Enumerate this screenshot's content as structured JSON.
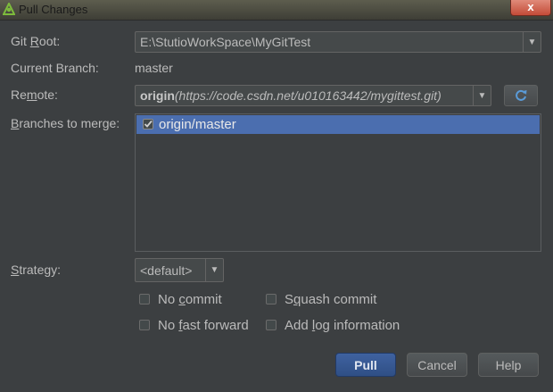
{
  "window": {
    "title": "Pull Changes",
    "close_label": "x"
  },
  "fields": {
    "git_root_label_pre": "Git ",
    "git_root_label_u": "R",
    "git_root_label_post": "oot:",
    "git_root_value": "E:\\StutioWorkSpace\\MyGitTest",
    "current_branch_label": "Current Branch:",
    "current_branch_value": "master",
    "remote_label_pre": "Re",
    "remote_label_u": "m",
    "remote_label_post": "ote:",
    "remote_name": "origin",
    "remote_url": "(https://code.csdn.net/u010163442/mygittest.git)",
    "branches_label_u": "B",
    "branches_label_post": "ranches to merge:",
    "branches": [
      {
        "name": "origin/master",
        "checked": true
      }
    ],
    "strategy_label_u": "S",
    "strategy_label_post": "trategy:",
    "strategy_value": "<default>"
  },
  "options": {
    "no_commit_pre": "No ",
    "no_commit_u": "c",
    "no_commit_post": "ommit",
    "squash_pre": "S",
    "squash_u": "q",
    "squash_post": "uash commit",
    "no_ff_pre": "No ",
    "no_ff_u": "f",
    "no_ff_post": "ast forward",
    "add_log_pre": "Add ",
    "add_log_u": "l",
    "add_log_post": "og information"
  },
  "buttons": {
    "pull": "Pull",
    "cancel": "Cancel",
    "help": "Help"
  },
  "icons": {
    "app": "android-icon",
    "refresh": "refresh-icon",
    "dropdown": "chevron-down-icon",
    "check": "checkmark-icon"
  },
  "colors": {
    "background": "#3c3f41",
    "selection": "#4b6eaf",
    "primary_button": "#365880",
    "text": "#bbbbbb"
  }
}
